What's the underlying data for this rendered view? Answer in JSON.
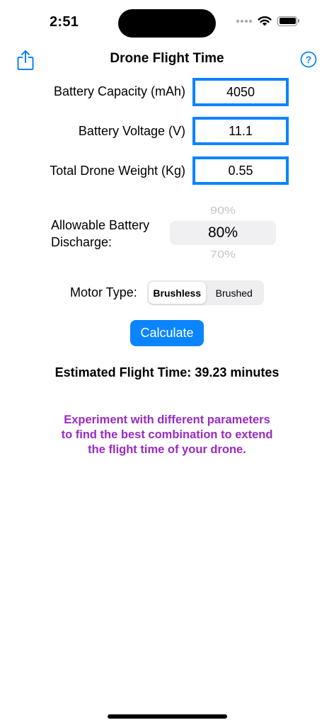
{
  "status_bar": {
    "time": "2:51"
  },
  "nav": {
    "title": "Drone Flight Time",
    "share_icon": "share-icon",
    "help_icon": "help-icon"
  },
  "fields": {
    "capacity": {
      "label": "Battery Capacity (mAh)",
      "value": "4050"
    },
    "voltage": {
      "label": "Battery Voltage (V)",
      "value": "11.1"
    },
    "weight": {
      "label": "Total Drone Weight (Kg)",
      "value": "0.55"
    }
  },
  "discharge": {
    "label_line1": "Allowable Battery",
    "label_line2": "Discharge:",
    "above": "90%",
    "selected": "80%",
    "below": "70%"
  },
  "motor": {
    "label": "Motor Type:",
    "options": [
      "Brushless",
      "Brushed"
    ],
    "selected": "Brushless"
  },
  "calculate_label": "Calculate",
  "result": {
    "label": "Estimated Flight Time:",
    "value": "39.23 minutes"
  },
  "tip": {
    "line1": "Experiment with different parameters",
    "line2": "to find the best combination to extend",
    "line3": "the flight time of your drone."
  },
  "colors": {
    "accent": "#0a84ff",
    "tip_text": "#9a2ac6"
  }
}
